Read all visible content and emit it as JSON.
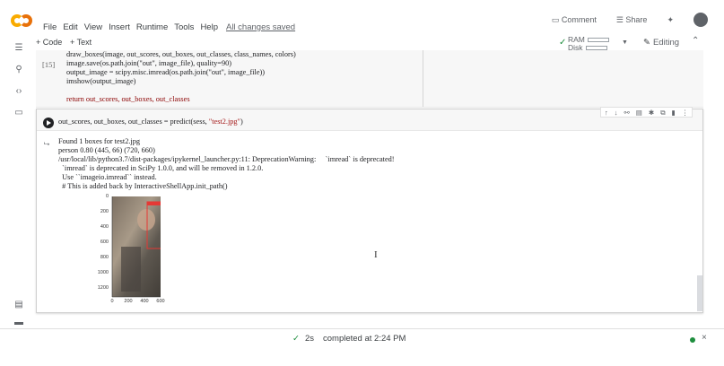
{
  "menu": {
    "items": [
      "File",
      "Edit",
      "View",
      "Insert",
      "Runtime",
      "Tools",
      "Help"
    ],
    "saved": "All changes saved"
  },
  "header_right": {
    "comment": "Comment",
    "share": "Share"
  },
  "toolbar": {
    "add_code": "+ Code",
    "add_text": "+ Text",
    "ram": "RAM",
    "disk": "Disk",
    "editing": "Editing"
  },
  "cell1": {
    "exec": "[15]",
    "lines": [
      "draw_boxes(image, out_scores, out_boxes, out_classes, class_names, colors)",
      "image.save(os.path.join(\"out\", image_file), quality=90)",
      "output_image = scipy.misc.imread(os.path.join(\"out\", image_file))",
      "imshow(output_image)",
      "",
      "return out_scores, out_boxes, out_classes"
    ]
  },
  "cell2": {
    "code_prefix": "out_scores, out_boxes, out_classes = predict(sess, ",
    "code_str": "\"test2.jpg\"",
    "code_suffix": ")",
    "output_lines": [
      "Found 1 boxes for test2.jpg",
      "person 0.80 (445, 66) (720, 660)",
      "/usr/local/lib/python3.7/dist-packages/ipykernel_launcher.py:11: DeprecationWarning:     `imread` is deprecated!",
      "  `imread` is deprecated in SciPy 1.0.0, and will be removed in 1.2.0.",
      "  Use ``imageio.imread`` instead.",
      "  # This is added back by InteractiveShellApp.init_path()"
    ]
  },
  "chart_data": {
    "type": "image-plot",
    "yticks": [
      "0",
      "200",
      "400",
      "600",
      "800",
      "1000",
      "1200"
    ],
    "xticks": [
      "0",
      "200",
      "400",
      "600"
    ],
    "ylim": [
      0,
      1300
    ],
    "xlim": [
      0,
      720
    ]
  },
  "status": {
    "duration": "2s",
    "message": "completed at 2:24 PM"
  },
  "colors": {
    "accent_green": "#1e8e3e",
    "box_red": "#e53935"
  }
}
